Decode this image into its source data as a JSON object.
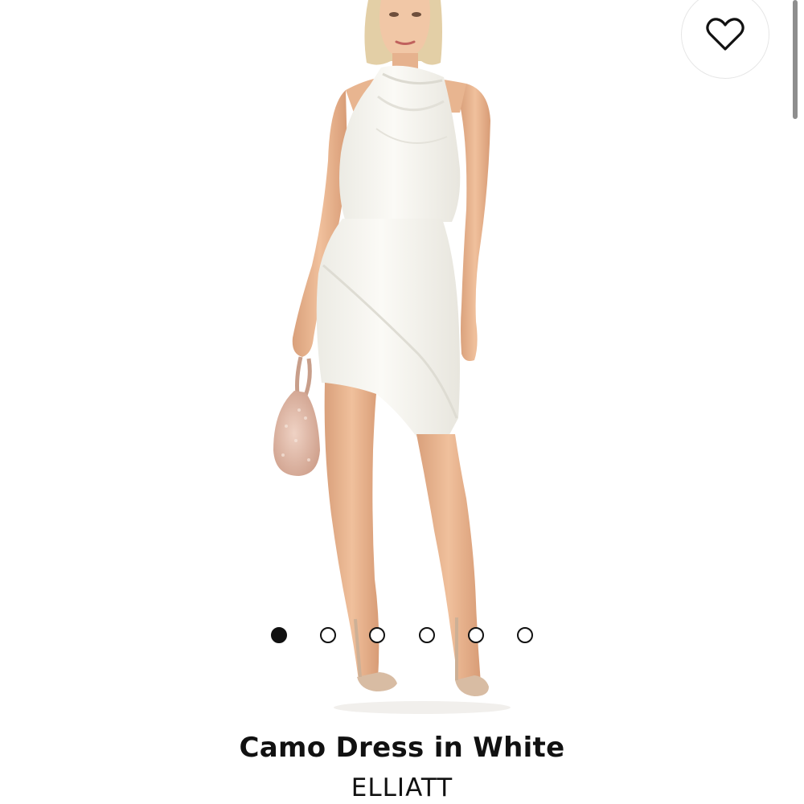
{
  "product": {
    "title": "Camo Dress in White",
    "brand": "ELLIATT"
  },
  "favorite_button": {
    "icon": "heart-outline-icon"
  },
  "gallery": {
    "image_count": 6,
    "active_index": 0
  },
  "colors": {
    "background": "#ffffff",
    "text": "#111111",
    "dot_active": "#111111",
    "dress": "#f7f5f0",
    "bag": "#e2bfae",
    "skin": "#e9b48f",
    "hair": "#e3cfa6"
  }
}
